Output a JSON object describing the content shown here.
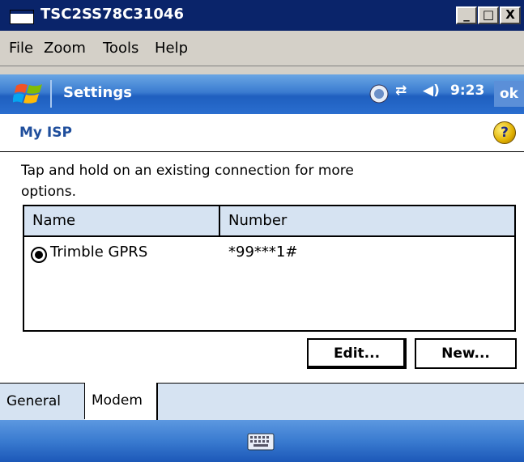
{
  "window": {
    "title": "TSC2SS78C31046",
    "buttons": [
      "_",
      "□",
      "X"
    ]
  },
  "menu": [
    "File",
    "Zoom",
    "Tools",
    "Help"
  ],
  "device_bar": {
    "title": "Settings",
    "time": "9:23",
    "ok_label": "ok",
    "tray_icons": [
      "sync-icon",
      "connectivity-icon",
      "volume-icon"
    ]
  },
  "page": {
    "title": "My ISP",
    "instructions": "Tap and hold on an existing connection for more options."
  },
  "list": {
    "columns": [
      "Name",
      "Number"
    ],
    "rows": [
      {
        "name": "Trimble GPRS",
        "number": "*99***1#",
        "selected": true
      }
    ]
  },
  "buttons": {
    "edit": "Edit...",
    "new": "New..."
  },
  "tabs": [
    {
      "label": "General",
      "active": false
    },
    {
      "label": "Modem",
      "active": true
    }
  ],
  "colors": {
    "accent": "#3a7bd0",
    "header_text": "#1f4e9c",
    "list_header_bg": "#d6e3f2"
  }
}
